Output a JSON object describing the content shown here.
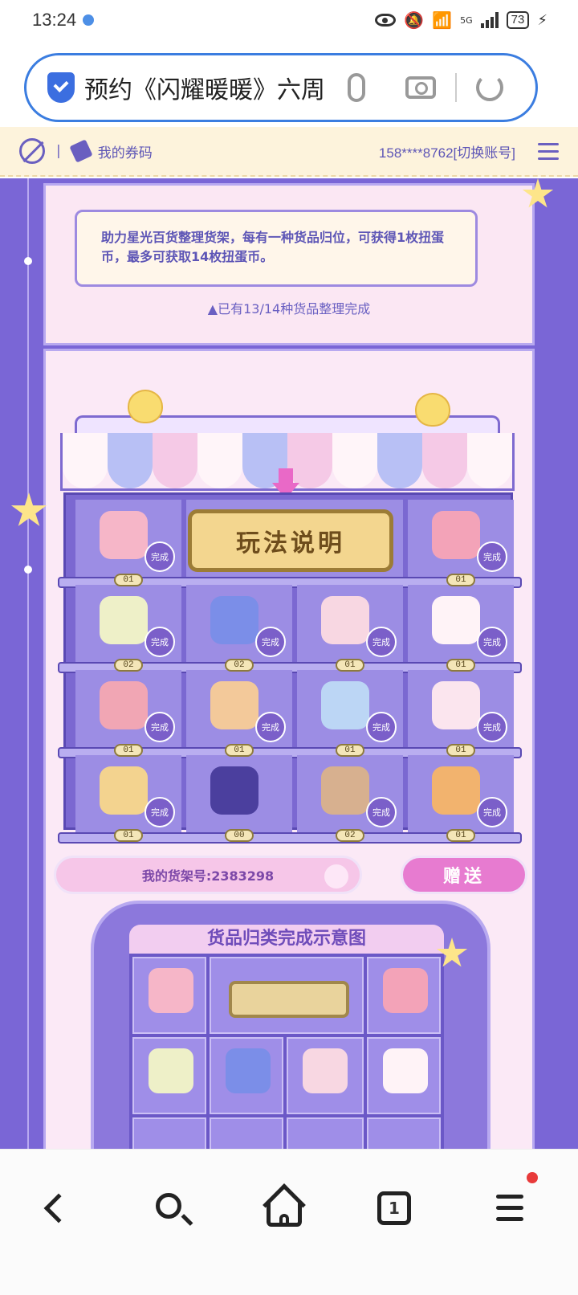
{
  "status_bar": {
    "time": "13:24",
    "network": "5G",
    "battery": "73"
  },
  "browser": {
    "search_text": "预约《闪耀暖暖》六周",
    "icons": [
      "shield-icon",
      "microphone-icon",
      "camera-icon",
      "reload-icon"
    ]
  },
  "site_header": {
    "coupon_label": "我的券码",
    "account": "158****8762[切换账号]"
  },
  "intro": {
    "notice": "助力星光百货整理货架，每有一种货品归位，可获得1枚扭蛋币，最多可获取14枚扭蛋币。",
    "progress": "已有13/14种货品整理完成"
  },
  "shelf": {
    "guide_label": "玩法说明",
    "done_label": "完成",
    "rows": [
      [
        {
          "name": "backpack",
          "count": "01",
          "done": true,
          "color": "#f6b6c8"
        },
        {
          "name": "guide",
          "count": "",
          "done": false,
          "color": ""
        },
        {
          "name": "guide",
          "count": "",
          "done": false,
          "color": ""
        },
        {
          "name": "photo-album",
          "count": "01",
          "done": true,
          "color": "#f3a3b8"
        }
      ],
      [
        {
          "name": "flower-basket",
          "count": "02",
          "done": true,
          "color": "#eef0c8"
        },
        {
          "name": "perfume",
          "count": "02",
          "done": true,
          "color": "#7b8ee8"
        },
        {
          "name": "shell-ring",
          "count": "01",
          "done": true,
          "color": "#f8d7e2"
        },
        {
          "name": "bunny-cup",
          "count": "01",
          "done": true,
          "color": "#fff3f7"
        }
      ],
      [
        {
          "name": "cat-hat",
          "count": "01",
          "done": true,
          "color": "#f1a6b4"
        },
        {
          "name": "suitcase",
          "count": "01",
          "done": true,
          "color": "#f3c99a"
        },
        {
          "name": "crystal-ball",
          "count": "01",
          "done": true,
          "color": "#bcd6f5"
        },
        {
          "name": "milk-box",
          "count": "01",
          "done": true,
          "color": "#fbe5ee"
        }
      ],
      [
        {
          "name": "moon-pillow",
          "count": "01",
          "done": true,
          "color": "#f3d38f"
        },
        {
          "name": "nikki-box",
          "count": "00",
          "done": false,
          "color": "#4b3f9e"
        },
        {
          "name": "cake",
          "count": "02",
          "done": true,
          "color": "#d7b08f"
        },
        {
          "name": "camera",
          "count": "01",
          "done": true,
          "color": "#f2b36e"
        }
      ]
    ]
  },
  "actions": {
    "shelf_number": "我的货架号:2383298",
    "give_label": "赠送"
  },
  "example": {
    "title": "货品归类完成示意图",
    "items": [
      {
        "name": "backpack",
        "color": "#f6b6c8"
      },
      {
        "name": "photo-album",
        "color": "#f3a3b8"
      },
      {
        "name": "flower-basket",
        "color": "#eef0c8"
      },
      {
        "name": "perfume",
        "color": "#7b8ee8"
      },
      {
        "name": "shell-ring",
        "color": "#f8d7e2"
      },
      {
        "name": "bunny-cup",
        "color": "#fff3f7"
      }
    ]
  },
  "theme": {
    "purple": "#7a66d6",
    "pink": "#fbe9f6",
    "accent": "#e77bd0"
  }
}
